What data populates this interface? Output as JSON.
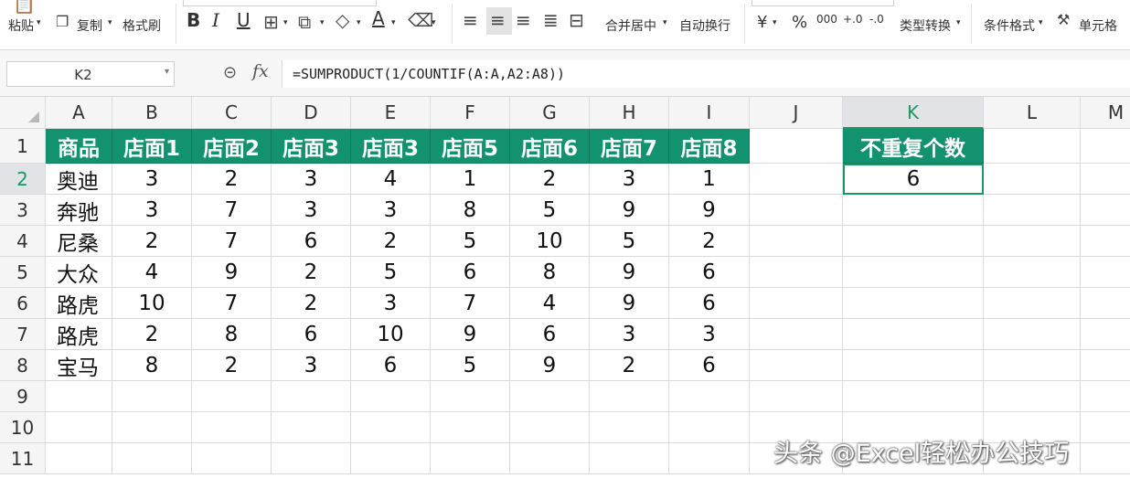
{
  "ribbon": {
    "paste_label": "粘贴",
    "copy_label": "复制",
    "format_painter_label": "格式刷",
    "bold_label": "B",
    "italic_label": "I",
    "underline_label": "U",
    "font_color_label": "A",
    "merge_center_label": "合并居中",
    "wrap_text_label": "自动换行",
    "currency_label": "¥",
    "percent_label": "%",
    "thousands_label": "000",
    "dec_inc_label": "+.0",
    "dec_dec_label": "-.0",
    "type_convert_label": "类型转换",
    "conditional_format_label": "条件格式",
    "cell_format_label": "单元格"
  },
  "formula_bar": {
    "name_box": "K2",
    "fx_label": "fx",
    "formula": "=SUMPRODUCT(1/COUNTIF(A:A,A2:A8))"
  },
  "columns": [
    "A",
    "B",
    "C",
    "D",
    "E",
    "F",
    "G",
    "H",
    "I",
    "J",
    "K",
    "L",
    "M"
  ],
  "row_numbers": [
    "1",
    "2",
    "3",
    "4",
    "5",
    "6",
    "7",
    "8",
    "9",
    "10",
    "11"
  ],
  "table": {
    "headers": [
      "商品",
      "店面1",
      "店面2",
      "店面3",
      "店面3",
      "店面5",
      "店面6",
      "店面7",
      "店面8"
    ],
    "rows": [
      [
        "奥迪",
        "3",
        "2",
        "3",
        "4",
        "1",
        "2",
        "3",
        "1"
      ],
      [
        "奔驰",
        "3",
        "7",
        "3",
        "3",
        "8",
        "5",
        "9",
        "9"
      ],
      [
        "尼桑",
        "2",
        "7",
        "6",
        "2",
        "5",
        "10",
        "5",
        "2"
      ],
      [
        "大众",
        "4",
        "9",
        "2",
        "5",
        "6",
        "8",
        "9",
        "6"
      ],
      [
        "路虎",
        "10",
        "7",
        "2",
        "3",
        "7",
        "4",
        "9",
        "6"
      ],
      [
        "路虎",
        "2",
        "8",
        "6",
        "10",
        "9",
        "6",
        "3",
        "3"
      ],
      [
        "宝马",
        "8",
        "2",
        "3",
        "6",
        "5",
        "9",
        "2",
        "6"
      ]
    ]
  },
  "result": {
    "header": "不重复个数",
    "value": "6"
  },
  "selected_cell": "K2",
  "colors": {
    "header_fill": "#139270",
    "header_text": "#ffffff",
    "selection": "#1a9a62"
  },
  "watermark": "头条 @Excel轻松办公技巧"
}
